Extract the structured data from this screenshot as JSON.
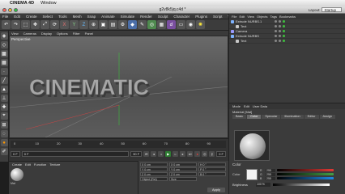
{
  "mac_menubar": {
    "app": "CINEMA 4D",
    "items": [
      "Window"
    ]
  },
  "window": {
    "title": "g2v8k5jq.c4d *",
    "layout_label": "Layout:",
    "layout_value": "Startup"
  },
  "app_menu": [
    "File",
    "Edit",
    "Create",
    "Select",
    "Tools",
    "Mesh",
    "Snap",
    "Animate",
    "Simulate",
    "Render",
    "Sculpt",
    "Character",
    "Plugins",
    "Script",
    "Window",
    "Help"
  ],
  "viewport": {
    "menu": [
      "View",
      "Cameras",
      "Display",
      "Options",
      "Filter",
      "Panel"
    ],
    "label": "Perspective",
    "text3d": "CINEMATIC"
  },
  "timeline": {
    "ticks": [
      "0",
      "10",
      "20",
      "30",
      "40",
      "50",
      "60",
      "70",
      "80",
      "90"
    ],
    "start": "0 F",
    "current": "0 F",
    "end": "90 F",
    "frame_readout": "0 F"
  },
  "material_manager": {
    "menu": [
      "Create",
      "Edit",
      "Function",
      "Texture"
    ],
    "material_name": "Mat"
  },
  "coordinates": {
    "rows": [
      [
        "X",
        "0 cm",
        "X",
        "0 cm",
        "H",
        "0 °"
      ],
      [
        "Y",
        "0 cm",
        "Y",
        "0 cm",
        "P",
        "0 °"
      ],
      [
        "Z",
        "0 cm",
        "Z",
        "0 cm",
        "B",
        "0 °"
      ]
    ],
    "mode": "Object (Rel)",
    "size_mode": "Size",
    "apply": "Apply"
  },
  "object_manager": {
    "menu": [
      "File",
      "Edit",
      "View",
      "Objects",
      "Tags",
      "Bookmarks"
    ],
    "objects": [
      {
        "name": "Extrude NURBS.1",
        "color": "#7fb3ff"
      },
      {
        "name": "Text",
        "color": "#c9c9c9"
      },
      {
        "name": "Camera",
        "color": "#9a9aff"
      },
      {
        "name": "Extrude NURBS",
        "color": "#7fb3ff"
      },
      {
        "name": "Text",
        "color": "#c9c9c9"
      }
    ]
  },
  "attribute_manager": {
    "menu": [
      "Mode",
      "Edit",
      "User Data"
    ],
    "title": "Material [Mat]",
    "tabs": [
      "Basic",
      "Color",
      "Specular",
      "Illumination",
      "Editor",
      "Assign"
    ],
    "active_tab": "Color",
    "color_label": "Color",
    "sub_color_label": "Color",
    "rgb": [
      {
        "ch": "R",
        "value": "255",
        "color": "#e53935"
      },
      {
        "ch": "G",
        "value": "255",
        "color": "#43a047"
      },
      {
        "ch": "B",
        "value": "255",
        "color": "#1e88e5"
      }
    ],
    "brightness_label": "Brightness",
    "brightness_value": "100 %"
  },
  "colors": {
    "ui_bg": "#3b3b3b",
    "accent_green": "#3fbf3f",
    "text3d": "#a6a6a6"
  }
}
